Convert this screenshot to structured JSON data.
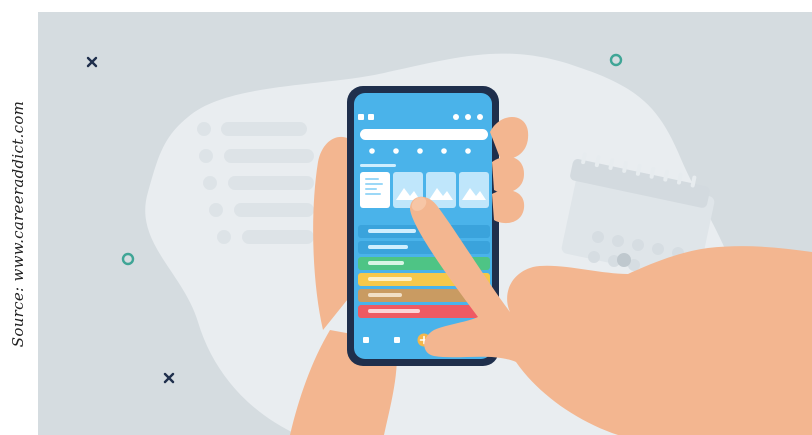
{
  "caption": {
    "text": "Source: www.careeraddict.com"
  },
  "illustration": {
    "subject": "hand-holding-phone-with-app",
    "colors": {
      "background": "#d5dce0",
      "blob": "#e9edf0",
      "phone_frame": "#1f2f4c",
      "screen": "#4ab3ea",
      "skin": "#f3b690",
      "accent_teal": "#3fa596",
      "row_green": "#4ec485",
      "row_yellow": "#f6c84a",
      "row_tan": "#c99b62",
      "row_red": "#ef5a63",
      "add_button": "#f5b74a"
    }
  }
}
